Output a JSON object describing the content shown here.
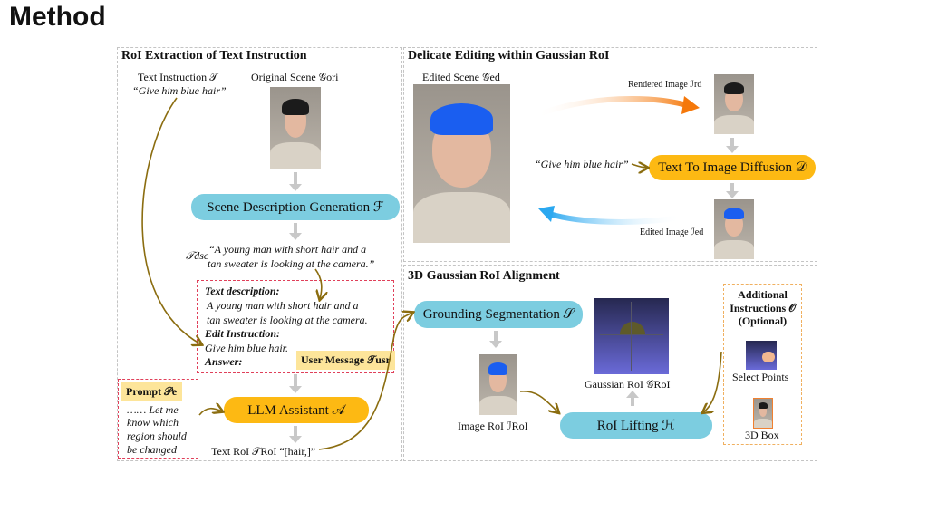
{
  "title": "Method",
  "panels": {
    "roi_extraction": {
      "heading": "RoI Extraction of Text Instruction",
      "text_instruction_label": "Text Instruction 𝒯",
      "text_instruction_value": "“Give him blue hair”",
      "original_scene_label": "Original Scene 𝒢ori",
      "scene_description_box": "Scene Description Generation ℱ",
      "tdsc_symbol": "𝒯dsc",
      "tdsc_text_line1": "“A young man with short hair and a",
      "tdsc_text_line2": "tan sweater is looking at the camera.”",
      "user_message": {
        "text_description_label": "Text description:",
        "text_description_line1": "A young man with short hair and a",
        "text_description_line2": "tan sweater is looking at the camera.",
        "edit_instruction_label": "Edit Instruction:",
        "edit_instruction_value": "Give him blue hair.",
        "answer_label": "Answer:",
        "tag": "User Message 𝒯usr"
      },
      "prompt": {
        "tag": "Prompt 𝒫e",
        "lines": [
          "…… Let me",
          "know which",
          "region should",
          "be changed"
        ]
      },
      "llm_box": "LLM Assistant 𝒜",
      "text_roi": "Text RoI 𝒯RoI “[hair,]”"
    },
    "delicate_editing": {
      "heading": "Delicate Editing within Gaussian RoI",
      "edited_scene_label": "Edited Scene 𝒢ed",
      "rendered_image_label": "Rendered Image ℐrd",
      "instruction_quote": "“Give him blue hair”",
      "diffusion_box": "Text To Image Diffusion 𝒟",
      "edited_image_label": "Edited Image ℐed"
    },
    "roi_alignment": {
      "heading": "3D Gaussian RoI Alignment",
      "grounding_box": "Grounding Segmentation 𝒮",
      "image_roi_label": "Image RoI ℐRoI",
      "gaussian_roi_label": "Gaussian RoI 𝒢RoI",
      "lifting_box": "RoI Lifting ℋ",
      "additional": {
        "title_line1": "Additional",
        "title_line2": "Instructions 𝒪",
        "title_line3": "(Optional)",
        "select_points": "Select Points",
        "box_3d": "3D Box"
      }
    }
  },
  "colors": {
    "cyan_box": "#7ccde0",
    "gold_box": "#fdb913",
    "tag_yellow": "#fde59a",
    "flow_arrow": "#8b6d10",
    "red_dash": "#e0405a",
    "orange_dash": "#f0b060"
  }
}
